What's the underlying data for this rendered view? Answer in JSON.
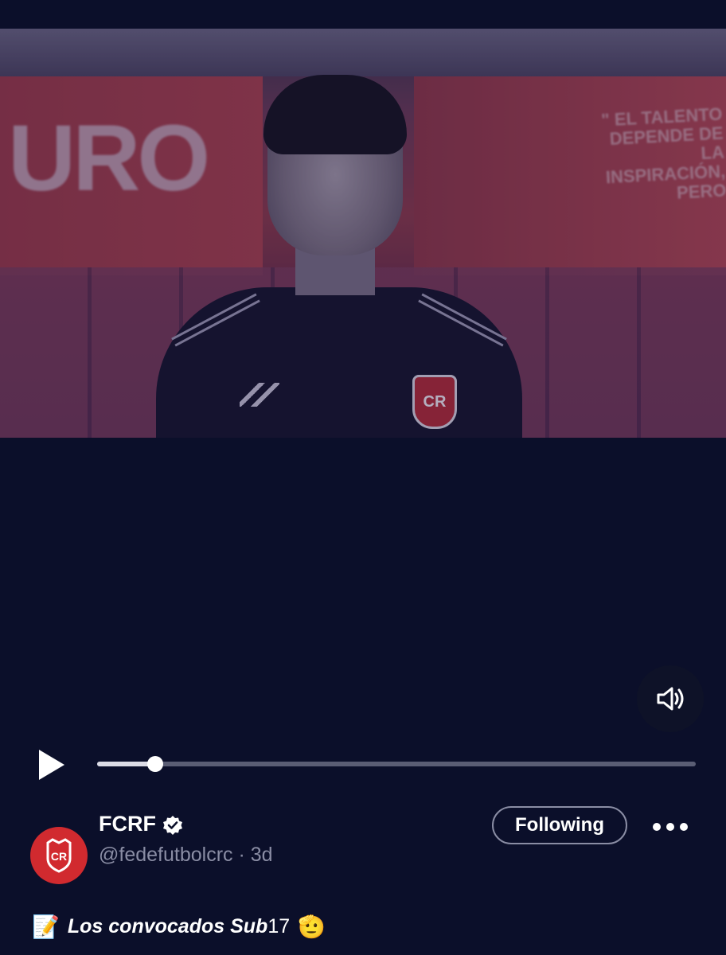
{
  "video": {
    "wall_text_left": "URO",
    "wall_text_right": "\" EL TALENTO DEPENDE DE LA INSPIRACIÓN, PERO",
    "crest_text": "CR",
    "progress_fraction": 0.097
  },
  "icons": {
    "sound": "speaker-volume-icon",
    "play": "play-icon",
    "verified": "verified-badge-icon",
    "more": "more-options-icon"
  },
  "account": {
    "display_name": "FCRF",
    "handle": "@fedefutbolcrc",
    "separator": "·",
    "time": "3d",
    "avatar_text": "CR",
    "follow_label": "Following"
  },
  "caption": {
    "emoji_start": "📝",
    "italic_text": "Los convocados Sub",
    "number_text": "17",
    "emoji_end": "🫡"
  },
  "colors": {
    "background": "#0b0f2a",
    "avatar": "#d12a2f",
    "secondary_text": "#8a8da4"
  }
}
